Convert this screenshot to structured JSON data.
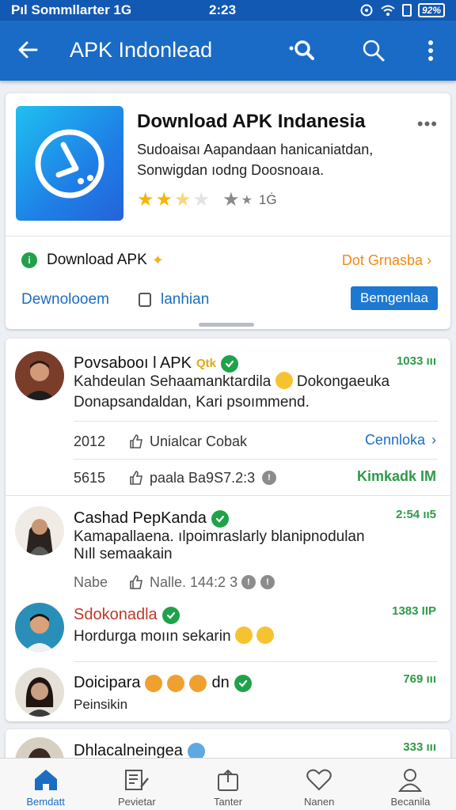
{
  "status_bar": {
    "carrier": "Pıl Sommllarter 1G",
    "time": "2:23",
    "battery": "92%"
  },
  "app_bar": {
    "title": "APK Indonlead",
    "icons": [
      "back-arrow-icon",
      "magic-search-icon",
      "search-icon",
      "more-vertical-icon"
    ]
  },
  "app_card": {
    "name": "Download APK Indanesia",
    "description_line1": "Sudoaisaı Aapandaan hanicaniatdan,",
    "description_line2": "Sonwigdan ıodng Doosnoaıa.",
    "rating_stars": 2.5,
    "rating_count": "1Ġ",
    "download_label": "Download APK",
    "download_right": "Dot Grnasba",
    "action_link1": "Dewnolooem",
    "action_link2": "lanhian",
    "action_button": "Bemgenlaa",
    "accent": "#1a6bc6"
  },
  "posts": [
    {
      "name": "Povsabooı l APK",
      "name_tag": "Qtk",
      "time": "1033 ııı",
      "text_line1": "Kahdeulan Sehaamanktardila",
      "text_line1_tail": "Dokongaeuka",
      "text_line2": "Donapsandaldan, Kari psoımmend.",
      "stat1_count": "2012",
      "stat1_label": "Unialcar Cobak",
      "stat1_right": "Cennloka",
      "stat2_count": "5615",
      "stat2_label": "paala Ba9S7.2:3",
      "stat2_right": "Kimkadk IM"
    },
    {
      "name": "Cashad PepKanda",
      "time": "2:54 ıı5",
      "text_line1": "Kamapallaena. ılpoimraslarly blanipnodulan",
      "text_line2": "Nıll semaakain",
      "stat_label1": "Nabe",
      "stat_label2": "Nalle. 144:2 3"
    },
    {
      "name": "Sdokonadla",
      "time": "1383 IIP",
      "text_line1": "Hordurga moıın sekarin"
    },
    {
      "name": "Doicipara",
      "name_tail": "dn",
      "time": "769 ııı",
      "text_line1": "Peinsikin"
    },
    {
      "name": "Dhlacalneingea",
      "time": "333 ııı"
    }
  ],
  "bottom_nav": [
    {
      "label": "Bemdatt",
      "icon": "home-icon",
      "active": true
    },
    {
      "label": "Pevietar",
      "icon": "edit-list-icon",
      "active": false
    },
    {
      "label": "Tanter",
      "icon": "share-icon",
      "active": false
    },
    {
      "label": "Nanen",
      "icon": "heart-icon",
      "active": false
    },
    {
      "label": "Becanila",
      "icon": "profile-icon",
      "active": false
    }
  ]
}
